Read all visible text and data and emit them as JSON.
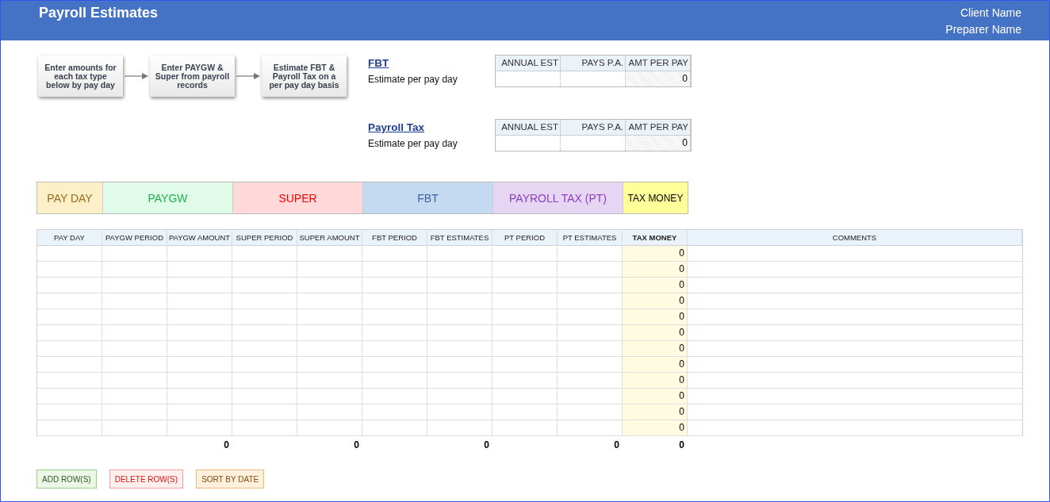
{
  "header": {
    "title": "Payroll Estimates",
    "client": "Client Name",
    "preparer": "Preparer Name"
  },
  "flow_steps": [
    "Enter amounts for each tax type below by pay day",
    "Enter PAYGW & Super from payroll records",
    "Estimate FBT & Payroll Tax on a per pay day basis"
  ],
  "estimates": [
    {
      "title": "FBT",
      "label": "Estimate per pay day",
      "columns": [
        "ANNUAL EST",
        "PAYS P.A.",
        "AMT PER PAY"
      ],
      "result": "0"
    },
    {
      "title": "Payroll Tax",
      "label": "Estimate per pay day",
      "columns": [
        "ANNUAL EST",
        "PAYS P.A.",
        "AMT PER PAY"
      ],
      "result": "0"
    }
  ],
  "categories": [
    {
      "label": "PAY DAY",
      "color": "#fdf0c8"
    },
    {
      "label": "PAYGW",
      "color": "#e0fbea"
    },
    {
      "label": "SUPER",
      "color": "#ffd9d9"
    },
    {
      "label": "FBT",
      "color": "#c4daf0"
    },
    {
      "label": "PAYROLL TAX (PT)",
      "color": "#e6d6f4"
    },
    {
      "label": "TAX MONEY",
      "color": "#ffff99"
    }
  ],
  "table": {
    "columns": [
      {
        "label": "PAY DAY",
        "kind": "input"
      },
      {
        "label": "PAYGW PERIOD",
        "kind": "input"
      },
      {
        "label": "PAYGW AMOUNT",
        "kind": "input",
        "total": "0"
      },
      {
        "label": "SUPER PERIOD",
        "kind": "input"
      },
      {
        "label": "SUPER AMOUNT",
        "kind": "input",
        "total": "0"
      },
      {
        "label": "FBT PERIOD",
        "kind": "input"
      },
      {
        "label": "FBT ESTIMATES",
        "kind": "input",
        "total": "0"
      },
      {
        "label": "PT PERIOD",
        "kind": "input"
      },
      {
        "label": "PT ESTIMATES",
        "kind": "input",
        "total": "0"
      },
      {
        "label": "TAX MONEY",
        "kind": "computed",
        "total": "0"
      },
      {
        "label": "COMMENTS",
        "kind": "comments"
      }
    ],
    "rows": [
      {
        "tax_money": "0"
      },
      {
        "tax_money": "0"
      },
      {
        "tax_money": "0"
      },
      {
        "tax_money": "0"
      },
      {
        "tax_money": "0"
      },
      {
        "tax_money": "0"
      },
      {
        "tax_money": "0"
      },
      {
        "tax_money": "0"
      },
      {
        "tax_money": "0"
      },
      {
        "tax_money": "0"
      },
      {
        "tax_money": "0"
      },
      {
        "tax_money": "0"
      }
    ]
  },
  "buttons": [
    {
      "label": "ADD ROW(S)",
      "kind": "add"
    },
    {
      "label": "DELETE ROW(S)",
      "kind": "delete"
    },
    {
      "label": "SORT BY DATE",
      "kind": "sort"
    }
  ]
}
